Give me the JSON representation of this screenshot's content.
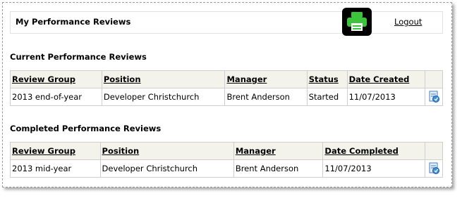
{
  "header": {
    "title": "My Performance Reviews",
    "print_icon": "printer-icon",
    "logout_label": "Logout"
  },
  "current": {
    "section_title": "Current Performance Reviews",
    "columns": [
      "Review Group",
      "Position",
      "Manager",
      "Status",
      "Date Created"
    ],
    "rows": [
      {
        "review_group": "2013 end-of-year",
        "position": "Developer Christchurch",
        "manager": "Brent Anderson",
        "status": "Started",
        "date": "11/07/2013",
        "icon": "open-review-icon"
      }
    ]
  },
  "completed": {
    "section_title": "Completed Performance Reviews",
    "columns": [
      "Review Group",
      "Position",
      "Manager",
      "Date Completed"
    ],
    "rows": [
      {
        "review_group": "2013 mid-year",
        "position": "Developer Christchurch",
        "manager": "Brent Anderson",
        "date": "11/07/2013",
        "icon": "open-review-icon"
      }
    ]
  }
}
